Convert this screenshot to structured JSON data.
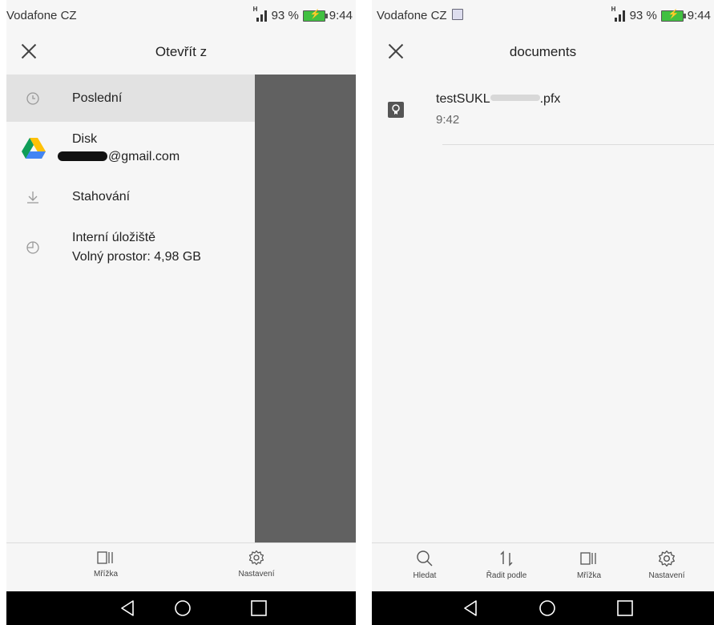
{
  "left": {
    "status": {
      "carrier": "Vodafone CZ",
      "battery": "93 %",
      "time": "9:44"
    },
    "appbar": {
      "title": "Otevřít z"
    },
    "drawer": {
      "recent": {
        "label": "Poslední"
      },
      "drive": {
        "label": "Disk",
        "account": "@gmail.com"
      },
      "downloads": {
        "label": "Stahování"
      },
      "internal": {
        "label": "Interní úložiště",
        "free": "Volný prostor: 4,98 GB"
      }
    },
    "bottom": {
      "grid": "Mřížka",
      "settings": "Nastavení"
    }
  },
  "right": {
    "status": {
      "carrier": "Vodafone CZ",
      "battery": "93 %",
      "time": "9:44"
    },
    "appbar": {
      "title": "documents"
    },
    "file": {
      "name_start": "testSUKL",
      "name_end": ".pfx",
      "time": "9:42"
    },
    "bottom": {
      "search": "Hledat",
      "sort": "Řadit podle",
      "grid": "Mřížka",
      "settings": "Nastavení"
    }
  },
  "icons": [
    "close-icon",
    "clock-icon",
    "drive-icon",
    "download-icon",
    "storage-icon",
    "file-certificate-icon",
    "search-icon",
    "sort-icon",
    "grid-icon",
    "gear-icon",
    "back-icon",
    "home-icon",
    "recents-icon"
  ],
  "colors": {
    "scrim": "#616161",
    "selected": "#e2e2e2",
    "navbar": "#000000",
    "battery": "#41c041",
    "background": "#f6f6f6"
  }
}
